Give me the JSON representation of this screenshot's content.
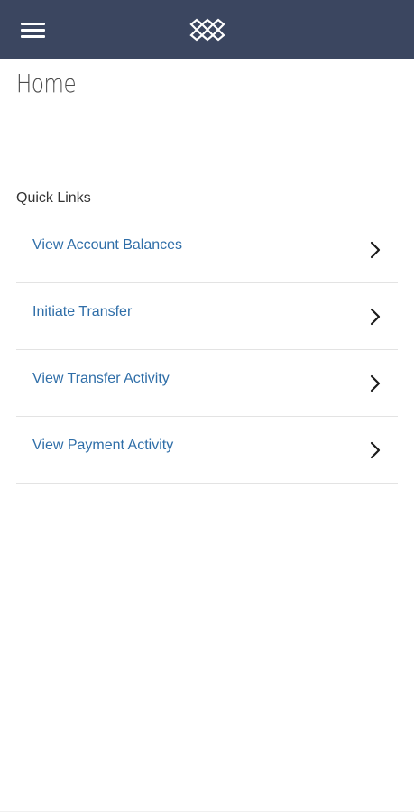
{
  "header": {
    "menu_icon": "hamburger-menu-icon",
    "logo_icon": "interlocking-rings-logo",
    "background_color": "#3b4660"
  },
  "page": {
    "title": "Home"
  },
  "quick_links": {
    "label": "Quick Links",
    "items": [
      {
        "label": "View Account Balances",
        "icon": "chevron-right-icon"
      },
      {
        "label": "Initiate Transfer",
        "icon": "chevron-right-icon"
      },
      {
        "label": "View Transfer Activity",
        "icon": "chevron-right-icon"
      },
      {
        "label": "View Payment Activity",
        "icon": "chevron-right-icon"
      }
    ],
    "link_color": "#2f6ea8"
  }
}
